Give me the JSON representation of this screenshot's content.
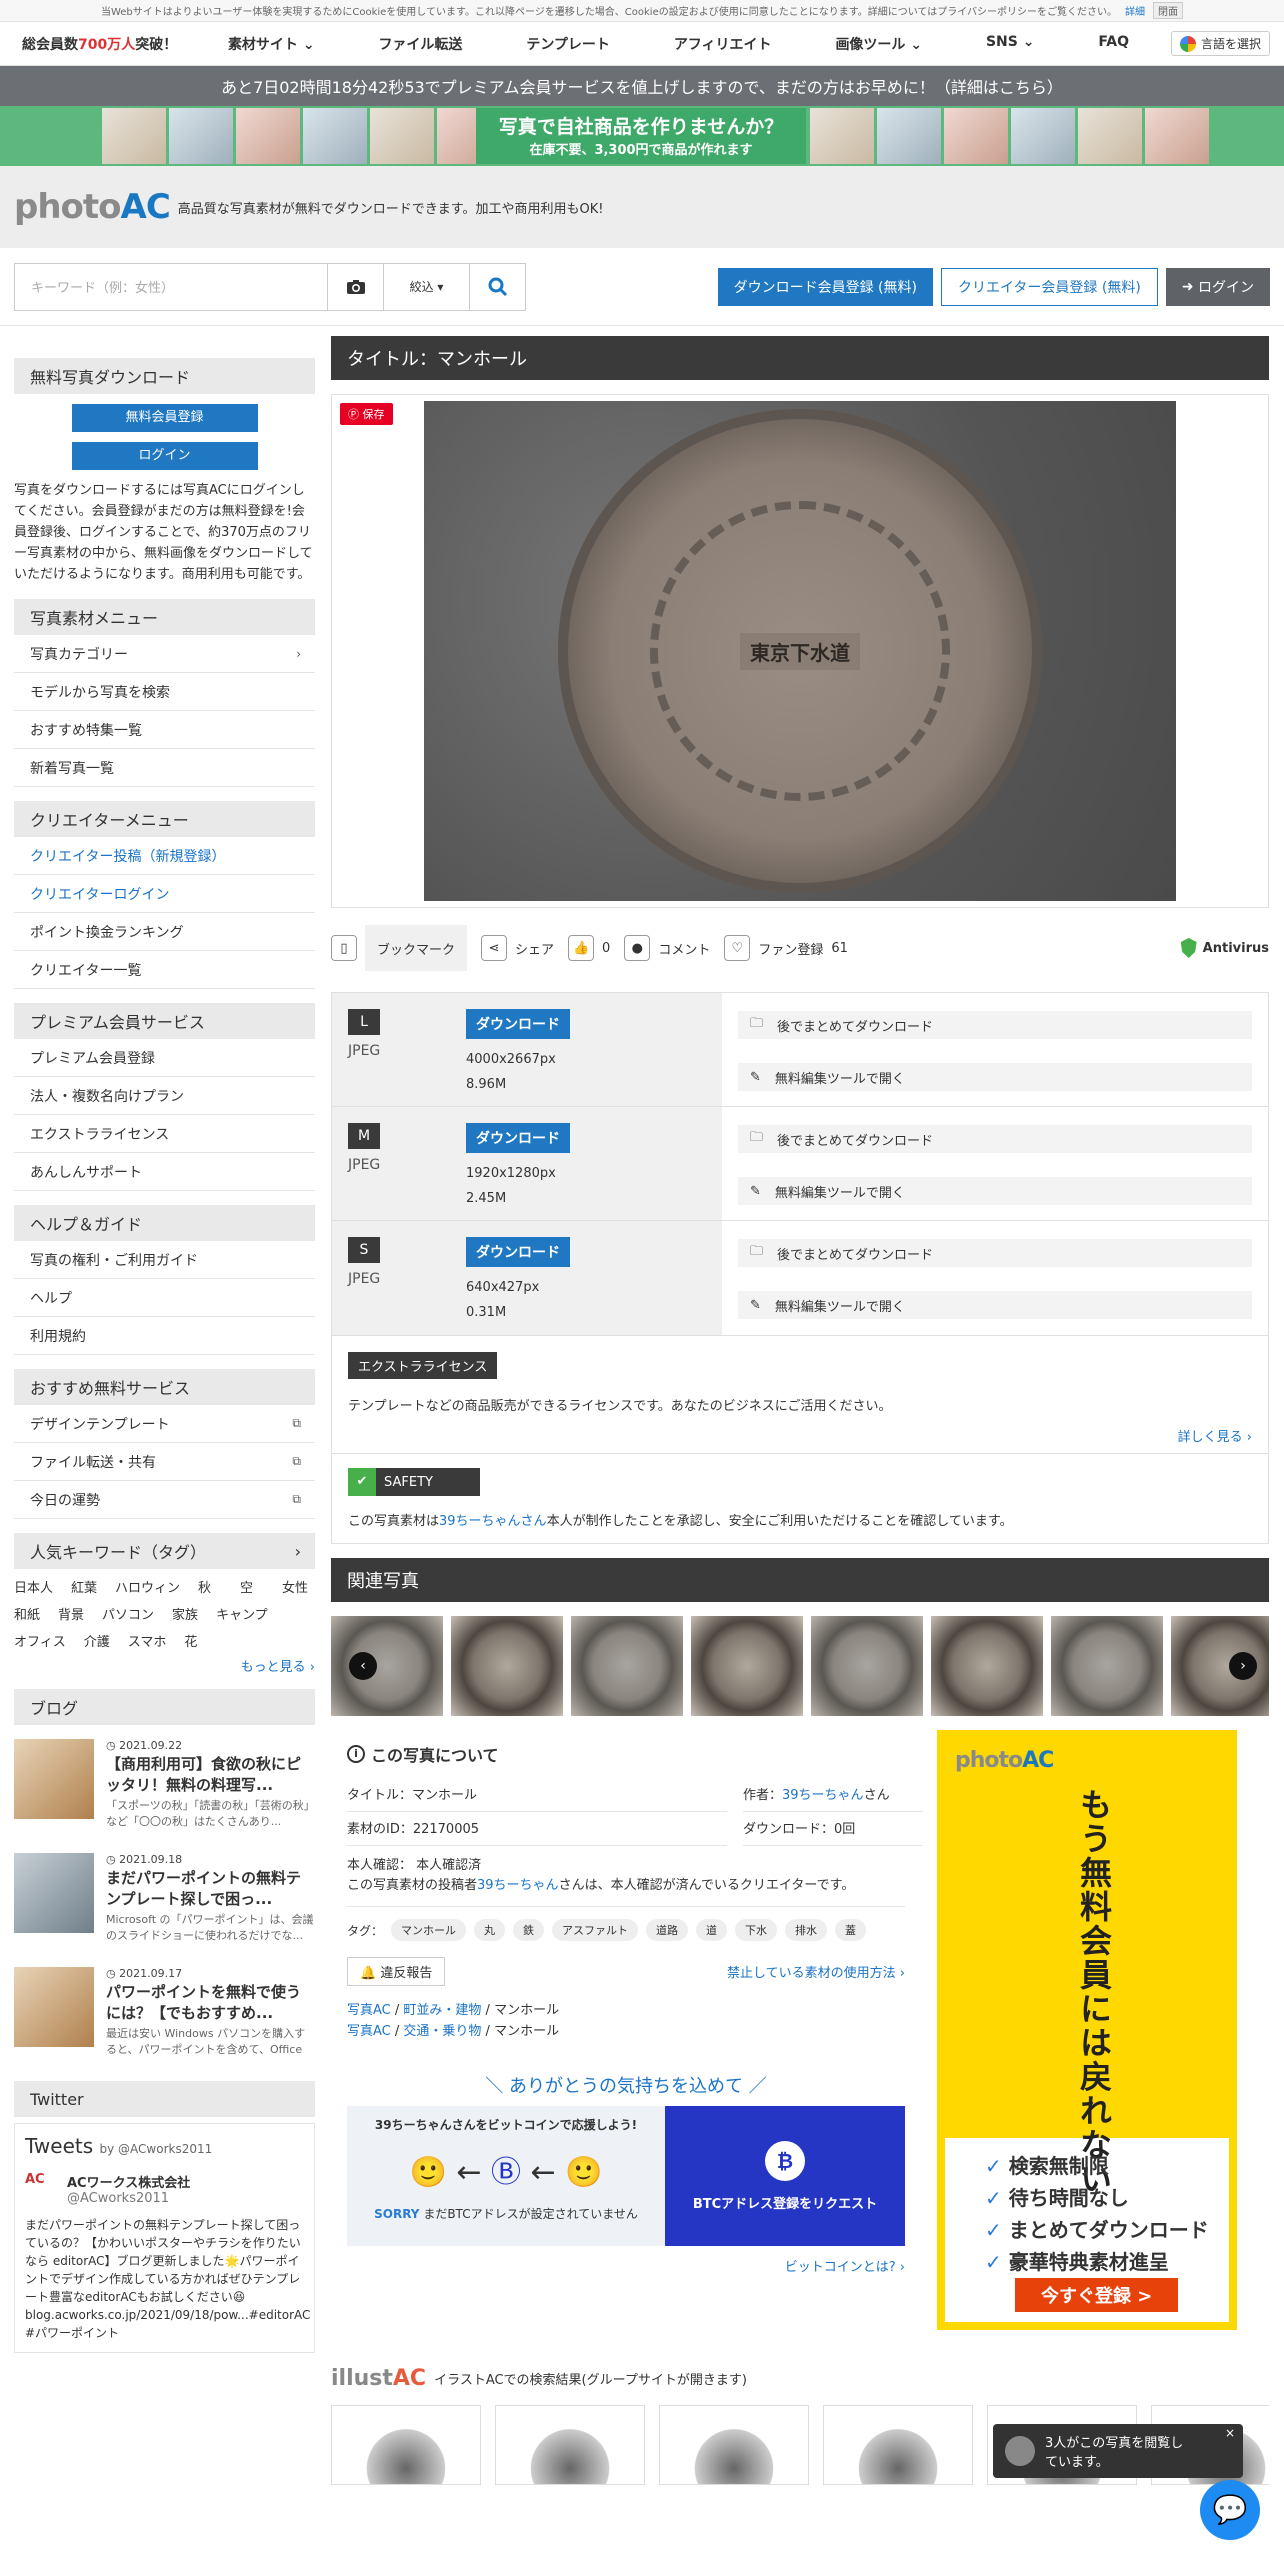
{
  "cookie": {
    "text": "当Webサイトはよりよいユーザー体験を実現するためにCookieを使用しています。これ以降ページを遷移した場合、Cookieの設定および使用に同意したことになります。詳細についてはプライバシーポリシーをご覧ください。",
    "detail": "詳細",
    "close": "閉面"
  },
  "topnav": {
    "stat_prefix": "総会員数",
    "stat_num": "700万人",
    "stat_suffix": "突破！",
    "items": [
      "素材サイト",
      "ファイル転送",
      "テンプレート",
      "アフィリエイト",
      "画像ツール",
      "SNS",
      "FAQ"
    ],
    "lang": "言語を選択"
  },
  "promo": "あと7日02時間18分42秒53でプレミアム会員サービスを値上げしますので、まだの方はお早めに！（詳細はこちら）",
  "banner": {
    "main": "写真で自社商品を作りませんか？",
    "sub": "在庫不要、3,300円で商品が作れます"
  },
  "logo": {
    "a": "photo",
    "b": "AC",
    "desc": "高品質な写真素材が無料でダウンロードできます。加工や商用利用もOK!"
  },
  "search": {
    "placeholder": "キーワード（例：女性）",
    "filter": "絞込 ▾"
  },
  "header_buttons": {
    "dl_register": "ダウンロード会員登録 (無料)",
    "creator_register": "クリエイター会員登録 (無料)",
    "login": "ログイン"
  },
  "sidebar": {
    "free_dl": "無料写真ダウンロード",
    "free_register": "無料会員登録",
    "login": "ログイン",
    "info": "写真をダウンロードするには写真ACにログインしてください。会員登録がまだの方は無料登録を!会員登録後、ログインすることで、約370万点のフリー写真素材の中から、無料画像をダウンロードしていただけるようになります。商用利用も可能です。",
    "menu_title": "写真素材メニュー",
    "menu": [
      "写真カテゴリー",
      "モデルから写真を検索",
      "おすすめ特集一覧",
      "新着写真一覧"
    ],
    "creator_title": "クリエイターメニュー",
    "creator": [
      "クリエイター投稿（新規登録）",
      "クリエイターログイン",
      "ポイント換金ランキング",
      "クリエイター一覧"
    ],
    "premium_title": "プレミアム会員サービス",
    "premium": [
      "プレミアム会員登録",
      "法人・複数名向けプラン",
      "エクストラライセンス",
      "あんしんサポート"
    ],
    "help_title": "ヘルプ＆ガイド",
    "help": [
      "写真の権利・ご利用ガイド",
      "ヘルプ",
      "利用規約"
    ],
    "svc_title": "おすすめ無料サービス",
    "svc": [
      "デザインテンプレート",
      "ファイル転送・共有",
      "今日の運勢"
    ],
    "kw_title": "人気キーワード（タグ）",
    "keywords": [
      "日本人",
      "紅葉",
      "ハロウィン",
      "秋",
      "空",
      "女性",
      "和紙",
      "背景",
      "パソコン",
      "家族",
      "キャンプ",
      "オフィス",
      "介護",
      "スマホ",
      "花"
    ],
    "more": "もっと見る",
    "blog_title": "ブログ",
    "blog": [
      {
        "date": "2021.09.22",
        "title": "【商用利用可】食欲の秋にピッタリ！無料の料理写...",
        "excerpt": "「スポーツの秋」「読書の秋」「芸術の秋」など「〇〇の秋」はたくさんあり..."
      },
      {
        "date": "2021.09.18",
        "title": "まだパワーポイントの無料テンプレート探しで困っ...",
        "excerpt": "Microsoft の「パワーポイント」は、会議のスライドショーに使われるだけでな..."
      },
      {
        "date": "2021.09.17",
        "title": "パワーポイントを無料で使うには？【でもおすすめ...",
        "excerpt": "最近は安い Windows パソコンを購入すると、パワーポイントを含めて、Office ..."
      }
    ],
    "twitter_title": "Twitter",
    "tweets": "Tweets",
    "tweets_by": "by @ACworks2011",
    "tw_name": "ACワークス株式会社",
    "tw_handle": "@ACworks2011",
    "tw_text": "まだパワーポイントの無料テンプレート探して困っているの？【かわいいポスターやチラシを作りたいなら editorAC】ブログ更新しました🌟パワーポイントでデザイン作成している方かればぜひテンプレート豊富なeditorACもお試しください😆 blog.acworks.co.jp/2021/09/18/pow...#editorAC #パワーポイント"
  },
  "main": {
    "title": "タイトル：マンホール",
    "save": "保存",
    "manhole_text": "東京下水道",
    "actions": {
      "bookmark": "ブックマーク",
      "share": "シェア",
      "likes": "0",
      "comment": "コメント",
      "fan": "ファン登録",
      "fan_count": "61",
      "antivirus": "Antivirus"
    },
    "downloads": [
      {
        "size": "L",
        "format": "JPEG",
        "pixels": "4000x2667px",
        "mb": "8.96M"
      },
      {
        "size": "M",
        "format": "JPEG",
        "pixels": "1920x1280px",
        "mb": "2.45M"
      },
      {
        "size": "S",
        "format": "JPEG",
        "pixels": "640x427px",
        "mb": "0.31M"
      }
    ],
    "dl_label": "ダウンロード",
    "later": "後でまとめてダウンロード",
    "edit": "無料編集ツールで開く",
    "license_tag": "エクストラライセンス",
    "license_text": "テンプレートなどの商品販売ができるライセンスです。あなたのビジネスにご活用ください。",
    "license_more": "詳しく見る",
    "safety_tag": "SAFETY",
    "safety_text_a": "この写真素材は",
    "safety_author": "39ちーちゃんさん",
    "safety_text_b": "本人が制作したことを承認し、安全にご利用いただけることを確認しています。",
    "related": "関連写真",
    "about_title": "この写真について",
    "about": {
      "title": "タイトル：マンホール",
      "author_label": "作者：",
      "author": "39ちーちゃん",
      "author_suffix": "さん",
      "id": "素材のID：22170005",
      "downloads": "ダウンロード：0回",
      "confirm": "本人確認： 本人確認済",
      "confirm_text_a": "この写真素材の投稿者",
      "confirm_author": "39ちーちゃん",
      "confirm_text_b": "さんは、本人確認が済んでいるクリエイターです。"
    },
    "tag_label": "タグ：",
    "tags": [
      "マンホール",
      "丸",
      "鉄",
      "アスファルト",
      "道路",
      "道",
      "下水",
      "排水",
      "蓋"
    ],
    "report": "違反報告",
    "forbidden": "禁止している素材の使用方法",
    "breadcrumbs": [
      [
        "写真AC",
        "町並み・建物",
        "マンホール"
      ],
      [
        "写真AC",
        "交通・乗り物",
        "マンホール"
      ]
    ],
    "thanks": "＼ ありがとうの気持ちを込めて ／",
    "btc_support": "39ちーちゃんさんをビットコインで応援しよう!",
    "btc_sorry": "SORRY",
    "btc_none": "まだBTCアドレスが設定されていません",
    "btc_request": "BTCアドレス登録をリクエスト",
    "btc_what": "ビットコインとは?",
    "ad_vertical": "もう無料会員には戻れない",
    "ad_list": [
      "検索無制限",
      "待ち時間なし",
      "まとめてダウンロード",
      "豪華特典素材進呈"
    ],
    "ad_button": "今すぐ登録 >",
    "illust_logo_a": "illust",
    "illust_logo_b": "AC",
    "illust_text": "イラストACでの検索結果(グループサイトが開きます)"
  },
  "notice": "3人がこの写真を閲覧しています。"
}
